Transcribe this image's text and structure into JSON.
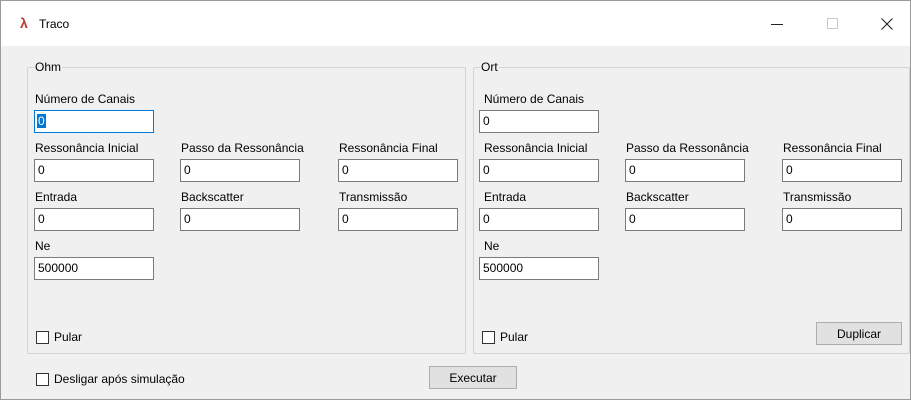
{
  "window": {
    "title": "Traco",
    "icon": "lambda-icon",
    "controls": {
      "minimize": "minimize-icon",
      "maximize": "maximize-icon",
      "close": "close-icon"
    }
  },
  "ohm": {
    "title": "Ohm",
    "num_canais_label": "Número de Canais",
    "num_canais_value": "0",
    "ress_inicial_label": "Ressonância Inicial",
    "ress_inicial_value": "0",
    "passo_label": "Passo da Ressonância",
    "passo_value": "0",
    "ress_final_label": "Ressonância Final",
    "ress_final_value": "0",
    "entrada_label": "Entrada",
    "entrada_value": "0",
    "backscatter_label": "Backscatter",
    "backscatter_value": "0",
    "transmissao_label": "Transmissão",
    "transmissao_value": "0",
    "ne_label": "Ne",
    "ne_value": "500000",
    "pular_label": "Pular"
  },
  "ort": {
    "title": "Ort",
    "num_canais_label": "Número de Canais",
    "num_canais_value": "0",
    "ress_inicial_label": "Ressonância Inicial",
    "ress_inicial_value": "0",
    "passo_label": "Passo da Ressonância",
    "passo_value": "0",
    "ress_final_label": "Ressonância Final",
    "ress_final_value": "0",
    "entrada_label": "Entrada",
    "entrada_value": "0",
    "backscatter_label": "Backscatter",
    "backscatter_value": "0",
    "transmissao_label": "Transmissão",
    "transmissao_value": "0",
    "ne_label": "Ne",
    "ne_value": "500000",
    "pular_label": "Pular",
    "duplicar_label": "Duplicar"
  },
  "footer": {
    "desligar_label": "Desligar após simulação",
    "executar_label": "Executar"
  }
}
